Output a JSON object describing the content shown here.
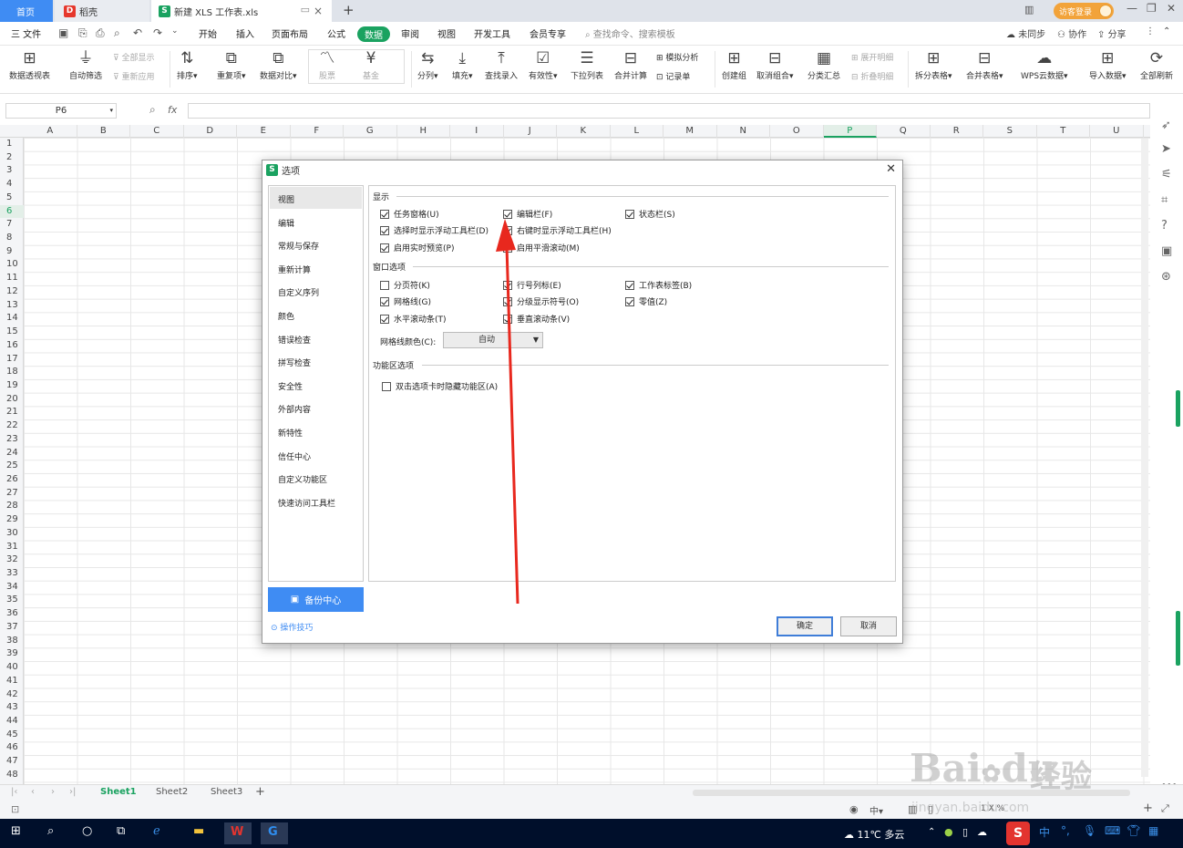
{
  "tabs": {
    "home": "首页",
    "daoke": "稻壳",
    "file": "新建 XLS 工作表.xls",
    "guest": "访客登录"
  },
  "menu": {
    "file": "三 文件",
    "items": [
      "开始",
      "插入",
      "页面布局",
      "公式",
      "数据",
      "审阅",
      "视图",
      "开发工具",
      "会员专享"
    ],
    "search": "查找命令、搜索模板",
    "sync": "未同步",
    "collab": "协作",
    "share": "分享"
  },
  "ribbon": {
    "pivot": "数据透视表",
    "autofilter": "自动筛选",
    "showall": "全部显示",
    "reapply": "重新应用",
    "sort": "排序",
    "dup": "重复项",
    "compare": "数据对比",
    "stock": "股票",
    "fund": "基金",
    "split": "分列",
    "fill": "填充",
    "lookup": "查找录入",
    "validity": "有效性",
    "dropdown": "下拉列表",
    "merge": "合并计算",
    "simulate": "模拟分析",
    "record": "记录单",
    "group": "创建组",
    "ungroup": "取消组合",
    "subtotal": "分类汇总",
    "expand": "展开明细",
    "collapse": "折叠明细",
    "splittable": "拆分表格",
    "mergetable": "合并表格",
    "cloud": "WPS云数据",
    "import": "导入数据",
    "refresh": "全部刷新"
  },
  "formula": {
    "cell": "P6",
    "fx": "fx"
  },
  "columns": [
    "A",
    "B",
    "C",
    "D",
    "E",
    "F",
    "G",
    "H",
    "I",
    "J",
    "K",
    "L",
    "M",
    "N",
    "O",
    "P",
    "Q",
    "R",
    "S",
    "T",
    "U"
  ],
  "rows": [
    "1",
    "2",
    "3",
    "4",
    "5",
    "6",
    "7",
    "8",
    "9",
    "10",
    "11",
    "12",
    "13",
    "14",
    "15",
    "16",
    "17",
    "18",
    "19",
    "20",
    "21",
    "22",
    "23",
    "24",
    "25",
    "26",
    "27",
    "28",
    "29",
    "30",
    "31",
    "32",
    "33",
    "34",
    "35",
    "36",
    "37",
    "38",
    "39",
    "40",
    "41",
    "42",
    "43",
    "44",
    "45",
    "46",
    "47",
    "48"
  ],
  "sheets": [
    "Sheet1",
    "Sheet2",
    "Sheet3"
  ],
  "dialog": {
    "title": "选项",
    "nav": [
      "视图",
      "编辑",
      "常规与保存",
      "重新计算",
      "自定义序列",
      "颜色",
      "错误检查",
      "拼写检查",
      "安全性",
      "外部内容",
      "新特性",
      "信任中心",
      "自定义功能区",
      "快速访问工具栏"
    ],
    "backup": "备份中心",
    "tips": "操作技巧",
    "sec_display": "显示",
    "sec_window": "窗口选项",
    "sec_ribbon": "功能区选项",
    "opts": {
      "taskpane": "任务窗格(U)",
      "formulabar": "编辑栏(F)",
      "statusbar": "状态栏(S)",
      "floatbar": "选择时显示浮动工具栏(D)",
      "rightfloat": "右键时显示浮动工具栏(H)",
      "preview": "启用实时预览(P)",
      "smooth": "启用平滑滚动(M)",
      "pagebreak": "分页符(K)",
      "rowcol": "行号列标(E)",
      "sheettabs": "工作表标签(B)",
      "gridlines": "网格线(G)",
      "outline": "分级显示符号(O)",
      "zero": "零值(Z)",
      "hscroll": "水平滚动条(T)",
      "vscroll": "垂直滚动条(V)",
      "hideribbon": "双击选项卡时隐藏功能区(A)"
    },
    "gridcolor_label": "网格线颜色(C):",
    "gridcolor_value": "自动",
    "ok": "确定",
    "cancel": "取消"
  },
  "status": {
    "zoom": "1 X %"
  },
  "taskbar": {
    "weather": "11℃ 多云",
    "ime": "中"
  },
  "watermark": {
    "brand": "Bai",
    "brand2": "经验",
    "url": "jingyan.baidu.com"
  },
  "colors": {
    "accent": "#1aa260",
    "blue": "#3f8cf3",
    "arrow": "#e8281e"
  }
}
